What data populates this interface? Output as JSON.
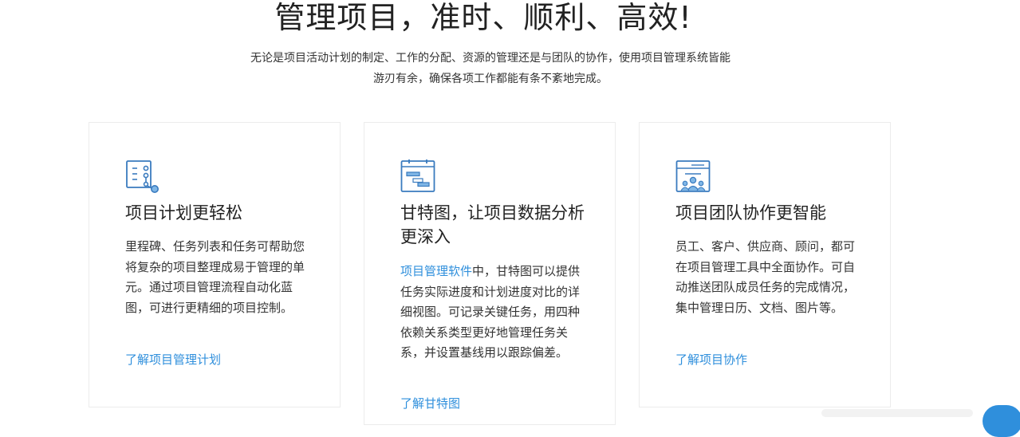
{
  "header": {
    "headline": "管理项目，准时、顺利、高效!",
    "subtitle_line1": "无论是项目活动计划的制定、工作的分配、资源的管理还是与团队的协作，使用项目管理系统皆能",
    "subtitle_line2": "游刃有余，确保各项工作都能有条不紊地完成。"
  },
  "cards": [
    {
      "icon": "flowchart-plan-icon",
      "title": "项目计划更轻松",
      "body": "里程碑、任务列表和任务可帮助您将复杂的项目整理成易于管理的单元。通过项目管理流程自动化蓝图，可进行更精细的项目控制。",
      "link": "了解项目管理计划"
    },
    {
      "icon": "gantt-chart-icon",
      "title": "甘特图，让项目数据分析更深入",
      "body_link": "项目管理软件",
      "body": "中，甘特图可以提供任务实际进度和计划进度对比的详细视图。可记录关键任务，用四种依赖关系类型更好地管理任务关系，并设置基线用以跟踪偏差。",
      "link": "了解甘特图"
    },
    {
      "icon": "team-collaboration-icon",
      "title": "项目团队协作更智能",
      "body": "员工、客户、供应商、顾问，都可在项目管理工具中全面协作。可自动推送团队成员任务的完成情况，集中管理日历、文档、图片等。",
      "link": "了解项目协作"
    }
  ],
  "colors": {
    "accent": "#2f8fdc",
    "icon_stroke": "#3a7bbf",
    "text": "#333333",
    "card_border": "#ececec"
  }
}
